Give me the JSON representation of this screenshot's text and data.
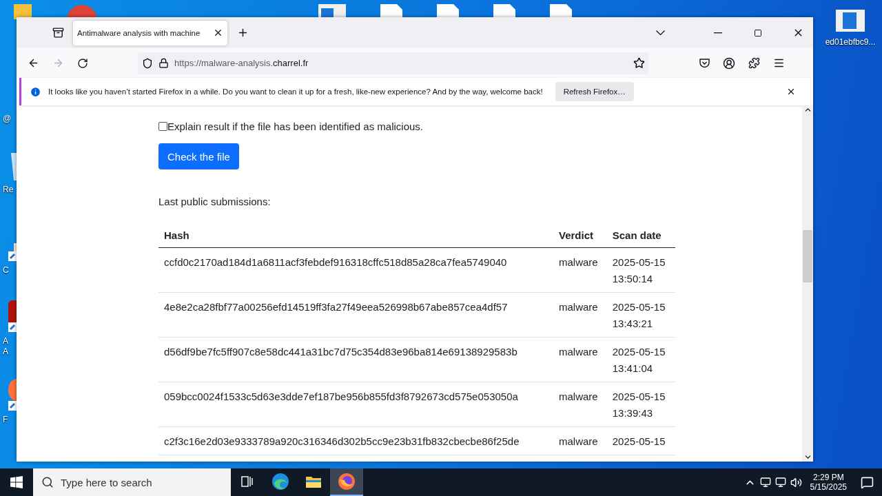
{
  "desktop_icons": [
    {
      "label": "@",
      "kind": "text"
    },
    {
      "label": "Re",
      "kind": "bin"
    },
    {
      "label": "C",
      "kind": "shortcut"
    },
    {
      "label": "A A",
      "kind": "app"
    },
    {
      "label": "F",
      "kind": "browser"
    }
  ],
  "desktop_file": {
    "label": "ed01ebfbc9..."
  },
  "browser": {
    "tabs": [
      {
        "title": "Antimalware analysis with machine",
        "selected": true
      }
    ],
    "url": {
      "prefix": "https://malware-analysis.",
      "domain": "charrel.fr"
    },
    "notification": {
      "message": "It looks like you haven’t started Firefox in a while. Do you want to clean it up for a fresh, like-new experience? And by the way, welcome back!",
      "button": "Refresh Firefox…"
    }
  },
  "page": {
    "checkbox": {
      "label": "Explain result if the file has been identified as malicious.",
      "checked": false
    },
    "submit_button": "Check the file",
    "section_title": "Last public submissions:",
    "table": {
      "columns": [
        "Hash",
        "Verdict",
        "Scan date"
      ],
      "rows": [
        {
          "hash": "ccfd0c2170ad184d1a6811acf3febdef916318cffc518d85a28ca7fea5749040",
          "verdict": "malware",
          "date": "2025-05-15",
          "time": "13:50:14"
        },
        {
          "hash": "4e8e2ca28fbf77a00256efd14519ff3fa27f49eea526998b67abe857cea4df57",
          "verdict": "malware",
          "date": "2025-05-15",
          "time": "13:43:21"
        },
        {
          "hash": "d56df9be7fc5ff907c8e58dc441a31bc7d75c354d83e96ba814e69138929583b",
          "verdict": "malware",
          "date": "2025-05-15",
          "time": "13:41:04"
        },
        {
          "hash": "059bcc0024f1533c5d63e3dde7ef187be956b855fd3f8792673cd575e053050a",
          "verdict": "malware",
          "date": "2025-05-15",
          "time": "13:39:43"
        },
        {
          "hash": "c2f3c16e2d03e9333789a920c316346d302b5cc9e23b31fb832cbecbe86f25de",
          "verdict": "malware",
          "date": "2025-05-15"
        }
      ]
    }
  },
  "taskbar": {
    "search_placeholder": "Type here to search",
    "apps": [
      {
        "kind": "taskview",
        "selected": false
      },
      {
        "kind": "edge",
        "selected": false
      },
      {
        "kind": "explorer",
        "selected": false
      },
      {
        "kind": "firefox",
        "selected": true
      }
    ],
    "time": "2:29 PM",
    "date": "5/15/2025"
  }
}
